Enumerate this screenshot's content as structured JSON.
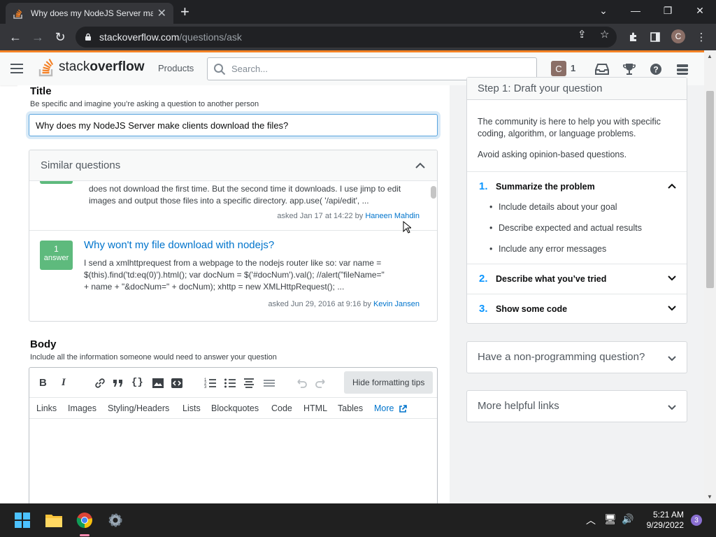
{
  "browser": {
    "tab_title": "Why does my NodeJS Server mal",
    "url_host": "stackoverflow.com",
    "url_path": "/questions/ask"
  },
  "so_header": {
    "logo_prefix": "stack",
    "logo_suffix": "overflow",
    "products": "Products",
    "search_placeholder": "Search...",
    "avatar_letter": "C",
    "reputation": "1",
    "brand_color": "#f48225"
  },
  "title_section": {
    "heading": "Title",
    "description": "Be specific and imagine you’re asking a question to another person",
    "value": "Why does my NodeJS Server make clients download the files?"
  },
  "similar": {
    "heading": "Similar questions",
    "questions": [
      {
        "excerpt": "does not download the first time. But the second time it downloads. I use jimp to edit images and output those files into a specific directory. app.use( '/api/edit', ...",
        "asked": "asked Jan 17 at 14:22 by",
        "user": "Haneen Mahdin"
      },
      {
        "answer_count": "1",
        "answer_label": "answer",
        "title": "Why won't my file download with nodejs?",
        "excerpt_lines": [
          "I send a xmlhttprequest from a webpage to the nodejs router like so: var name =",
          "$(this).find('td:eq(0)').html(); var docNum = $('#docNum').val(); //alert(\"fileName=\"",
          "+ name + \"&docNum=\" + docNum); xhttp = new XMLHttpRequest(); ..."
        ],
        "asked": "asked Jun 29, 2016 at 9:16 by",
        "user": "Kevin Jansen"
      }
    ]
  },
  "body_section": {
    "heading": "Body",
    "description": "Include all the information someone would need to answer your question",
    "hide_tips": "Hide formatting tips",
    "tips": [
      "Links",
      "Images",
      "Styling/Headers",
      "Lists",
      "Blockquotes",
      "Code",
      "HTML",
      "Tables",
      "More"
    ]
  },
  "sidebar": {
    "step_heading": "Step 1: Draft your question",
    "intro": "The community is here to help you with specific coding, algorithm, or language problems.",
    "avoid": "Avoid asking opinion-based questions.",
    "steps": [
      {
        "num": "1.",
        "label": "Summarize the problem"
      },
      {
        "num": "2.",
        "label": "Describe what you’ve tried"
      },
      {
        "num": "3.",
        "label": "Show some code"
      }
    ],
    "bullets": [
      "Include details about your goal",
      "Describe expected and actual results",
      "Include any error messages"
    ],
    "non_programming": "Have a non-programming question?",
    "more_links": "More helpful links"
  },
  "taskbar": {
    "time": "5:21 AM",
    "date": "9/29/2022",
    "notifications": "3"
  }
}
